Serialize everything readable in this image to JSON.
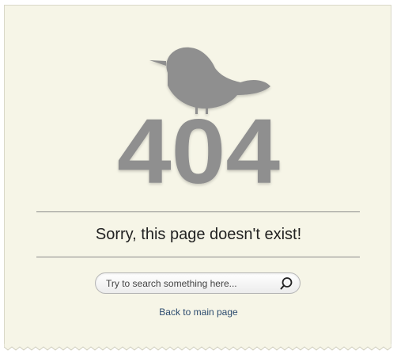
{
  "error": {
    "code": "404",
    "message": "Sorry, this page doesn't exist!"
  },
  "search": {
    "placeholder": "Try to search something here...",
    "value": "",
    "icon": "search-icon"
  },
  "links": {
    "back": "Back to main page"
  },
  "colors": {
    "background": "#f6f5e7",
    "graphic": "#8f8f8f",
    "link": "#2b4a6e",
    "text": "#222222"
  }
}
